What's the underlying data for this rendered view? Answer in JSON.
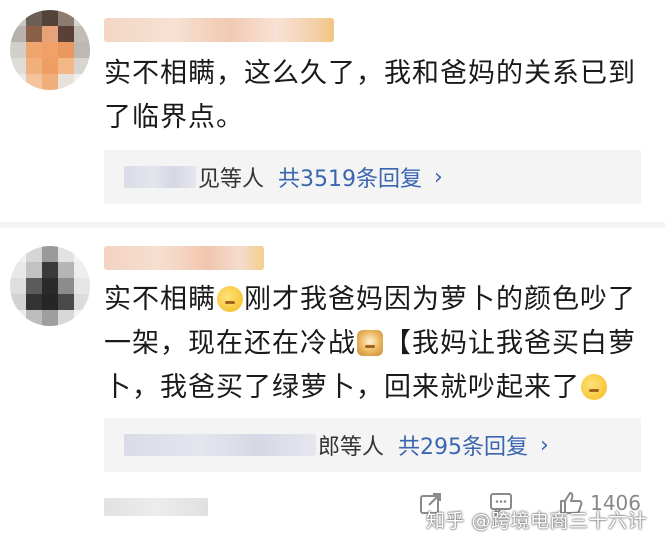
{
  "comments": [
    {
      "text": "实不相瞒，这么久了，我和爸妈的关系已到了临界点。",
      "replies": {
        "visible_suffix": "见等人",
        "count_label": "共3519条回复",
        "chevron": "›"
      }
    },
    {
      "text_parts": [
        "实不相瞒",
        "刚才我爸妈因为萝卜的颜色吵了一架，现在还在冷战",
        "【我妈让我爸买白萝卜，我爸买了绿萝卜，回来就吵起来了"
      ],
      "replies": {
        "visible_suffix": "郎等人",
        "count_label": "共295条回复",
        "chevron": "›"
      },
      "likes": "1406"
    }
  ],
  "icons": [
    "share-icon",
    "comment-icon",
    "like-icon",
    "smile-emoji-icon",
    "doge-emoji-icon"
  ],
  "watermark": "知乎 @跨境电商三十六计",
  "colors": {
    "link": "#3a65b0",
    "reply_bg": "#f4f4f4",
    "text": "#1a1a1a"
  }
}
